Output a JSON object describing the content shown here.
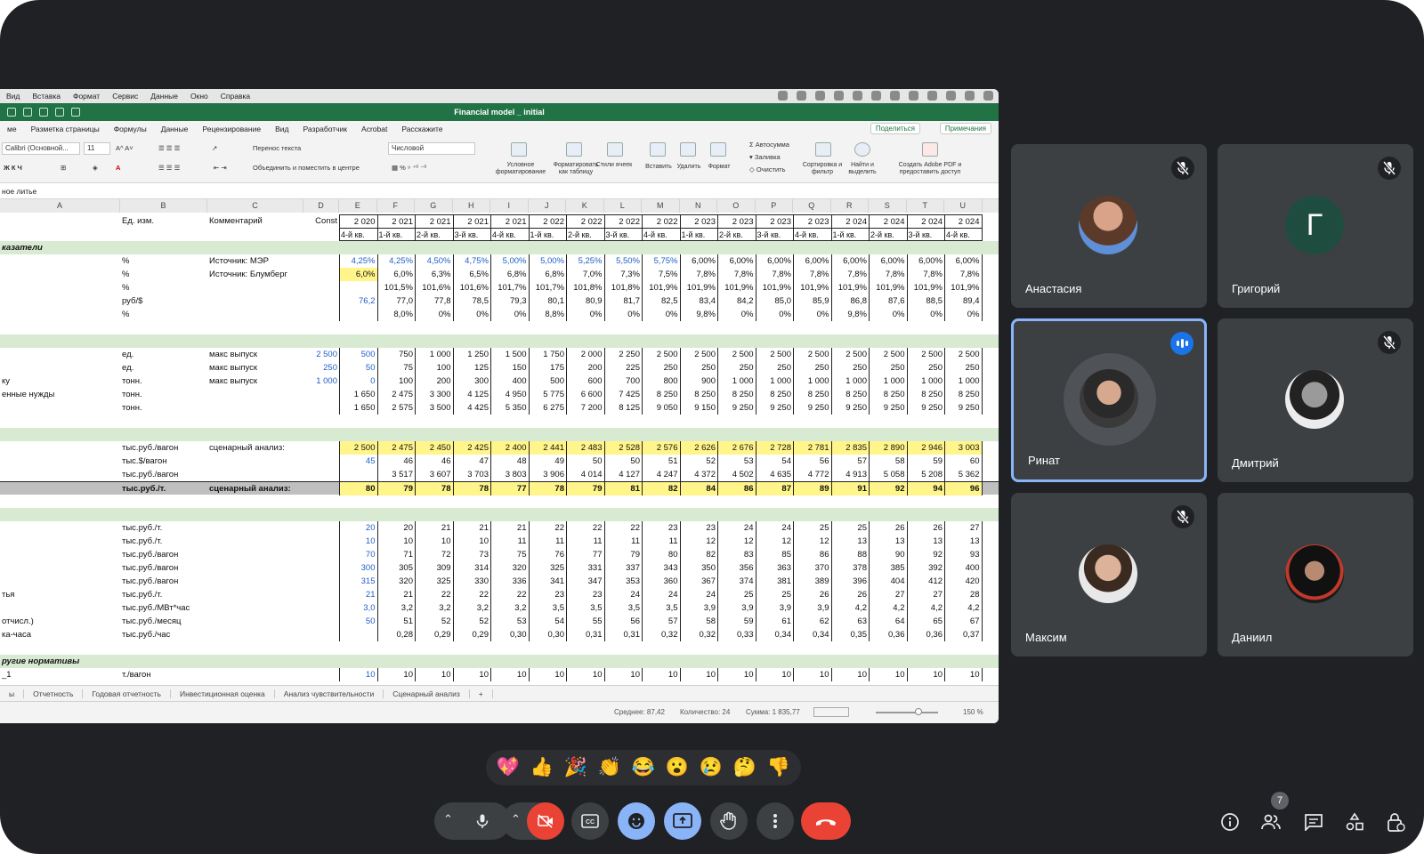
{
  "menubar": {
    "items": [
      "Вид",
      "Вставка",
      "Формат",
      "Сервис",
      "Данные",
      "Окно",
      "Справка"
    ]
  },
  "titlebar": {
    "title": "Financial model _ initial"
  },
  "ribbon_tabs": {
    "items": [
      "ме",
      "Разметка страницы",
      "Формулы",
      "Данные",
      "Рецензирование",
      "Вид",
      "Разработчик",
      "Acrobat",
      "Расскажите"
    ],
    "share": "Поделиться",
    "notes": "Примечания"
  },
  "ribbon": {
    "font_name": "Calibri (Основной...",
    "font_size": "11",
    "wrap_text": "Перенос текста",
    "merge_center": "Объединить и поместить в центре",
    "number_format": "Числовой",
    "conditional_format": "Условное форматирование",
    "format_as_table": "Форматировать как таблицу",
    "cell_styles": "Стили ячеек",
    "insert": "Вставить",
    "delete": "Удалить",
    "format": "Формат",
    "autosum": "Автосумма",
    "fill": "Заливка",
    "clear": "Очистить",
    "sort_filter": "Сортировка и фильтр",
    "find_select": "Найти и выделить",
    "create_pdf": "Создать Adobe PDF и предоставить доступ"
  },
  "formula_bar": {
    "text": "ное литье"
  },
  "grid": {
    "col_letters": [
      "A",
      "B",
      "C",
      "D",
      "E",
      "F",
      "G",
      "H",
      "I",
      "J",
      "K",
      "L",
      "M",
      "N",
      "O",
      "P",
      "Q",
      "R",
      "S",
      "T",
      "U"
    ],
    "years": [
      "2 020",
      "2 021",
      "2 021",
      "2 021",
      "2 021",
      "2 022",
      "2 022",
      "2 022",
      "2 022",
      "2 023",
      "2 023",
      "2 023",
      "2 023",
      "2 024",
      "2 024",
      "2 024",
      "2 024"
    ],
    "quarters": [
      "4-й кв.",
      "1-й кв.",
      "2-й кв.",
      "3-й кв.",
      "4-й кв.",
      "1-й кв.",
      "2-й кв.",
      "3-й кв.",
      "4-й кв.",
      "1-й кв.",
      "2-й кв.",
      "3-й кв.",
      "4-й кв.",
      "1-й кв.",
      "2-й кв.",
      "3-й кв.",
      "4-й кв."
    ],
    "head_unit": "Ед. изм.",
    "head_comment": "Комментарий",
    "head_const": "Const",
    "rows": [
      {
        "type": "sec",
        "a": "казатели"
      },
      {
        "a": "",
        "b": "%",
        "c": "Источник: МЭР",
        "d": "",
        "v": [
          "4,25%",
          "4,25%",
          "4,50%",
          "4,75%",
          "5,00%",
          "5,00%",
          "5,25%",
          "5,50%",
          "5,75%",
          "6,00%",
          "6,00%",
          "6,00%",
          "6,00%",
          "6,00%",
          "6,00%",
          "6,00%",
          "6,00%"
        ],
        "blue": 9
      },
      {
        "a": "",
        "b": "%",
        "c": "Источник: Блумберг",
        "d": "",
        "v": [
          "6,0%",
          "6,0%",
          "6,3%",
          "6,5%",
          "6,8%",
          "6,8%",
          "7,0%",
          "7,3%",
          "7,5%",
          "7,8%",
          "7,8%",
          "7,8%",
          "7,8%",
          "7,8%",
          "7,8%",
          "7,8%",
          "7,8%"
        ],
        "yel_first": true
      },
      {
        "a": "",
        "b": "%",
        "c": "",
        "d": "",
        "v": [
          "",
          "101,5%",
          "101,6%",
          "101,6%",
          "101,7%",
          "101,7%",
          "101,8%",
          "101,8%",
          "101,9%",
          "101,9%",
          "101,9%",
          "101,9%",
          "101,9%",
          "101,9%",
          "101,9%",
          "101,9%",
          "101,9%"
        ]
      },
      {
        "a": "",
        "b": "руб/$",
        "c": "",
        "d": "",
        "v": [
          "76,2",
          "77,0",
          "77,8",
          "78,5",
          "79,3",
          "80,1",
          "80,9",
          "81,7",
          "82,5",
          "83,4",
          "84,2",
          "85,0",
          "85,9",
          "86,8",
          "87,6",
          "88,5",
          "89,4"
        ],
        "blue": 1
      },
      {
        "a": "",
        "b": "%",
        "c": "",
        "d": "",
        "v": [
          "",
          "8,0%",
          "0%",
          "0%",
          "0%",
          "8,8%",
          "0%",
          "0%",
          "0%",
          "9,8%",
          "0%",
          "0%",
          "0%",
          "9,8%",
          "0%",
          "0%",
          "0%"
        ]
      },
      {
        "type": "blank"
      },
      {
        "type": "sec",
        "a": ""
      },
      {
        "a": "",
        "b": "ед.",
        "c": "макс выпуск",
        "d": "2 500",
        "v": [
          "500",
          "750",
          "1 000",
          "1 250",
          "1 500",
          "1 750",
          "2 000",
          "2 250",
          "2 500",
          "2 500",
          "2 500",
          "2 500",
          "2 500",
          "2 500",
          "2 500",
          "2 500",
          "2 500"
        ],
        "blue": 1
      },
      {
        "a": "",
        "b": "ед.",
        "c": "макс выпуск",
        "d": "250",
        "v": [
          "50",
          "75",
          "100",
          "125",
          "150",
          "175",
          "200",
          "225",
          "250",
          "250",
          "250",
          "250",
          "250",
          "250",
          "250",
          "250",
          "250"
        ],
        "blue": 1
      },
      {
        "a": "ку",
        "b": "тонн.",
        "c": "макс выпуск",
        "d": "1 000",
        "v": [
          "0",
          "100",
          "200",
          "300",
          "400",
          "500",
          "600",
          "700",
          "800",
          "900",
          "1 000",
          "1 000",
          "1 000",
          "1 000",
          "1 000",
          "1 000",
          "1 000"
        ],
        "blue": 1
      },
      {
        "a": "енные нужды",
        "b": "тонн.",
        "c": "",
        "d": "",
        "v": [
          "1 650",
          "2 475",
          "3 300",
          "4 125",
          "4 950",
          "5 775",
          "6 600",
          "7 425",
          "8 250",
          "8 250",
          "8 250",
          "8 250",
          "8 250",
          "8 250",
          "8 250",
          "8 250",
          "8 250"
        ]
      },
      {
        "a": "",
        "b": "тонн.",
        "c": "",
        "d": "",
        "v": [
          "1 650",
          "2 575",
          "3 500",
          "4 425",
          "5 350",
          "6 275",
          "7 200",
          "8 125",
          "9 050",
          "9 150",
          "9 250",
          "9 250",
          "9 250",
          "9 250",
          "9 250",
          "9 250",
          "9 250"
        ]
      },
      {
        "type": "blank"
      },
      {
        "type": "sec",
        "a": ""
      },
      {
        "a": "",
        "b": "тыс.руб./вагон",
        "c": "сценарный анализ:",
        "d": "",
        "v": [
          "2 500",
          "2 475",
          "2 450",
          "2 425",
          "2 400",
          "2 441",
          "2 483",
          "2 528",
          "2 576",
          "2 626",
          "2 676",
          "2 728",
          "2 781",
          "2 835",
          "2 890",
          "2 946",
          "3 003"
        ],
        "yel_all": true
      },
      {
        "a": "",
        "b": "тыс.$/вагон",
        "c": "",
        "d": "",
        "v": [
          "45",
          "46",
          "46",
          "47",
          "48",
          "49",
          "50",
          "50",
          "51",
          "52",
          "53",
          "54",
          "56",
          "57",
          "58",
          "59",
          "60"
        ],
        "blue": 1
      },
      {
        "a": "",
        "b": "тыс.руб./вагон",
        "c": "",
        "d": "",
        "v": [
          "",
          "3 517",
          "3 607",
          "3 703",
          "3 803",
          "3 906",
          "4 014",
          "4 127",
          "4 247",
          "4 372",
          "4 502",
          "4 635",
          "4 772",
          "4 913",
          "5 058",
          "5 208",
          "5 362"
        ]
      },
      {
        "a": "",
        "b": "тыс.руб./т.",
        "c": "сценарный анализ:",
        "d": "",
        "v": [
          "80",
          "79",
          "78",
          "78",
          "77",
          "78",
          "79",
          "81",
          "82",
          "84",
          "86",
          "87",
          "89",
          "91",
          "92",
          "94",
          "96"
        ],
        "selrow": true
      },
      {
        "type": "blank"
      },
      {
        "type": "sec",
        "a": ""
      },
      {
        "a": "",
        "b": "тыс.руб./т.",
        "c": "",
        "d": "",
        "v": [
          "20",
          "20",
          "21",
          "21",
          "21",
          "22",
          "22",
          "22",
          "23",
          "23",
          "24",
          "24",
          "25",
          "25",
          "26",
          "26",
          "27"
        ],
        "blue": 1
      },
      {
        "a": "",
        "b": "тыс.руб./т.",
        "c": "",
        "d": "",
        "v": [
          "10",
          "10",
          "10",
          "10",
          "11",
          "11",
          "11",
          "11",
          "11",
          "12",
          "12",
          "12",
          "12",
          "13",
          "13",
          "13",
          "13"
        ],
        "blue": 1
      },
      {
        "a": "",
        "b": "тыс.руб./вагон",
        "c": "",
        "d": "",
        "v": [
          "70",
          "71",
          "72",
          "73",
          "75",
          "76",
          "77",
          "79",
          "80",
          "82",
          "83",
          "85",
          "86",
          "88",
          "90",
          "92",
          "93"
        ],
        "blue": 1
      },
      {
        "a": "",
        "b": "тыс.руб./вагон",
        "c": "",
        "d": "",
        "v": [
          "300",
          "305",
          "309",
          "314",
          "320",
          "325",
          "331",
          "337",
          "343",
          "350",
          "356",
          "363",
          "370",
          "378",
          "385",
          "392",
          "400"
        ],
        "blue": 1
      },
      {
        "a": "",
        "b": "тыс.руб./вагон",
        "c": "",
        "d": "",
        "v": [
          "315",
          "320",
          "325",
          "330",
          "336",
          "341",
          "347",
          "353",
          "360",
          "367",
          "374",
          "381",
          "389",
          "396",
          "404",
          "412",
          "420"
        ],
        "blue": 1
      },
      {
        "a": "тья",
        "b": "тыс.руб./т.",
        "c": "",
        "d": "",
        "v": [
          "21",
          "21",
          "22",
          "22",
          "22",
          "23",
          "23",
          "24",
          "24",
          "24",
          "25",
          "25",
          "26",
          "26",
          "27",
          "27",
          "28"
        ],
        "blue": 1
      },
      {
        "a": "",
        "b": "тыс.руб./МВт*час",
        "c": "",
        "d": "",
        "v": [
          "3,0",
          "3,2",
          "3,2",
          "3,2",
          "3,2",
          "3,5",
          "3,5",
          "3,5",
          "3,5",
          "3,9",
          "3,9",
          "3,9",
          "3,9",
          "4,2",
          "4,2",
          "4,2",
          "4,2"
        ],
        "blue": 1
      },
      {
        "a": "отчисл.)",
        "b": "тыс.руб./месяц",
        "c": "",
        "d": "",
        "v": [
          "50",
          "51",
          "52",
          "52",
          "53",
          "54",
          "55",
          "56",
          "57",
          "58",
          "59",
          "61",
          "62",
          "63",
          "64",
          "65",
          "67"
        ],
        "blue": 1
      },
      {
        "a": "ка-часа",
        "b": "тыс.руб./час",
        "c": "",
        "d": "",
        "v": [
          "",
          "0,28",
          "0,29",
          "0,29",
          "0,30",
          "0,30",
          "0,31",
          "0,31",
          "0,32",
          "0,32",
          "0,33",
          "0,34",
          "0,34",
          "0,35",
          "0,36",
          "0,36",
          "0,37"
        ]
      },
      {
        "type": "blank"
      },
      {
        "type": "sec",
        "a": "ругие нормативы"
      },
      {
        "a": "_1",
        "b": "т./вагон",
        "c": "",
        "d": "",
        "v": [
          "10",
          "10",
          "10",
          "10",
          "10",
          "10",
          "10",
          "10",
          "10",
          "10",
          "10",
          "10",
          "10",
          "10",
          "10",
          "10",
          "10"
        ],
        "blue": 1
      }
    ]
  },
  "sheet_tabs": [
    "ы",
    "Отчетность",
    "Годовая отчетность",
    "Инвестиционная оценка",
    "Анализ чувствительности",
    "Сценарный анализ",
    "+"
  ],
  "status": {
    "avg": "Среднее: 87,42",
    "count": "Количество: 24",
    "sum": "Сумма: 1 835,77",
    "zoom": "150 %"
  },
  "participants": [
    {
      "name": "Анастасия",
      "initial": "",
      "muted": true
    },
    {
      "name": "Григорий",
      "initial": "Г",
      "muted": true
    },
    {
      "name": "Ринат",
      "initial": "",
      "speaking": true
    },
    {
      "name": "Дмитрий",
      "initial": "",
      "muted": true
    },
    {
      "name": "Максим",
      "initial": "",
      "muted": true
    },
    {
      "name": "Даниил",
      "initial": "",
      "muted": false
    }
  ],
  "reactions": [
    "💖",
    "👍",
    "🎉",
    "👏",
    "😂",
    "😮",
    "😢",
    "🤔",
    "👎"
  ],
  "people_count": "7",
  "colors": {
    "excel_green": "#217346",
    "meet_bg": "#202124",
    "tile_bg": "#3c4043",
    "end_call": "#ea4335",
    "accent_blue": "#8ab4f8"
  }
}
